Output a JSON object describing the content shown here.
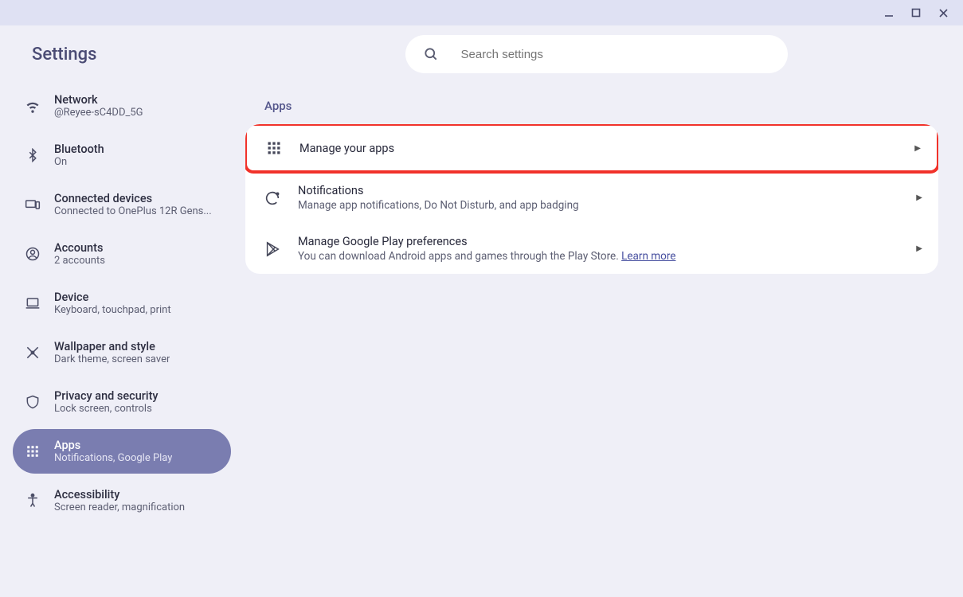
{
  "window": {
    "app_title": "Settings"
  },
  "search": {
    "placeholder": "Search settings"
  },
  "sidebar": {
    "items": [
      {
        "label": "Network",
        "sub": "@Reyee-sC4DD_5G",
        "icon": "wifi"
      },
      {
        "label": "Bluetooth",
        "sub": "On",
        "icon": "bluetooth"
      },
      {
        "label": "Connected devices",
        "sub": "Connected to OnePlus 12R Gens...",
        "icon": "devices"
      },
      {
        "label": "Accounts",
        "sub": "2 accounts",
        "icon": "account"
      },
      {
        "label": "Device",
        "sub": "Keyboard, touchpad, print",
        "icon": "laptop"
      },
      {
        "label": "Wallpaper and style",
        "sub": "Dark theme, screen saver",
        "icon": "wallpaper"
      },
      {
        "label": "Privacy and security",
        "sub": "Lock screen, controls",
        "icon": "shield"
      },
      {
        "label": "Apps",
        "sub": "Notifications, Google Play",
        "icon": "apps",
        "active": true
      },
      {
        "label": "Accessibility",
        "sub": "Screen reader, magnification",
        "icon": "accessibility"
      }
    ]
  },
  "main": {
    "section_title": "Apps",
    "rows": [
      {
        "title": "Manage your apps",
        "sub": "",
        "icon": "apps",
        "highlight": true
      },
      {
        "title": "Notifications",
        "sub": "Manage app notifications, Do Not Disturb, and app badging",
        "icon": "refresh"
      },
      {
        "title": "Manage Google Play preferences",
        "sub_prefix": "You can download Android apps and games through the Play Store. ",
        "learn_more": "Learn more",
        "icon": "play"
      }
    ]
  }
}
